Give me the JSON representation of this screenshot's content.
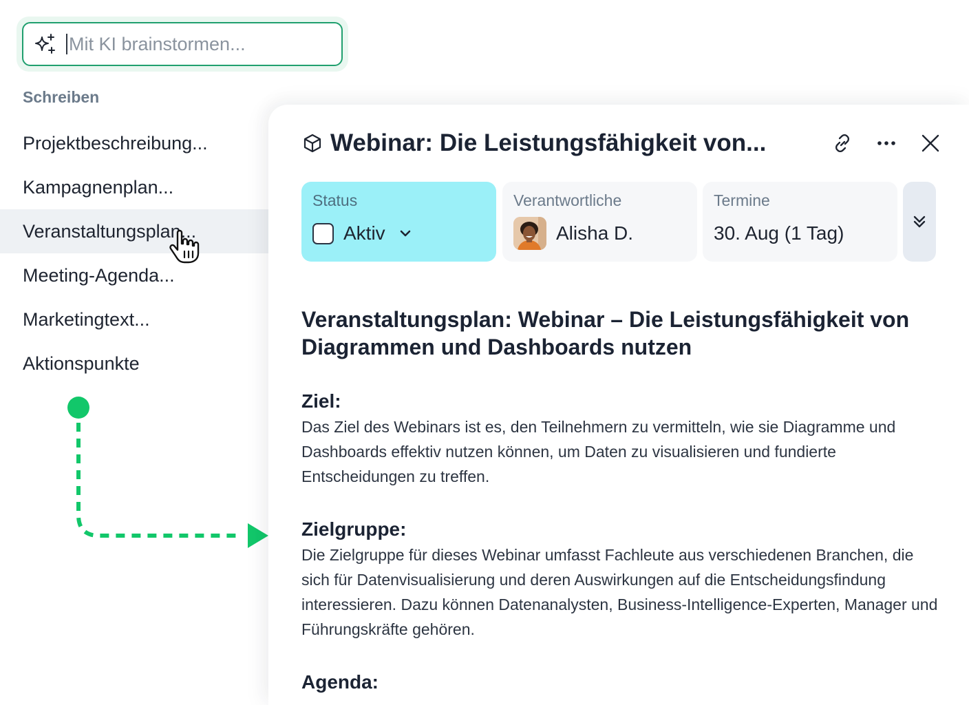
{
  "ai_input": {
    "placeholder": "Mit KI brainstormen...",
    "icon": "sparkles-icon"
  },
  "menu": {
    "section_label": "Schreiben",
    "items": [
      {
        "label": "Projektbeschreibung..."
      },
      {
        "label": "Kampagnenplan..."
      },
      {
        "label": "Veranstaltungsplan..."
      },
      {
        "label": "Meeting-Agenda..."
      },
      {
        "label": "Marketingtext..."
      },
      {
        "label": "Aktionspunkte"
      }
    ],
    "active_index": 2
  },
  "panel": {
    "title": "Webinar: Die Leistungsfähigkeit von...",
    "icons": [
      "cube-icon",
      "link-icon",
      "more-icon",
      "close-icon"
    ],
    "fields": {
      "status": {
        "label": "Status",
        "value": "Aktiv"
      },
      "owner": {
        "label": "Verantwortliche",
        "value": "Alisha D."
      },
      "dates": {
        "label": "Termine",
        "value": "30. Aug (1 Tag)"
      }
    }
  },
  "document": {
    "title": "Veranstaltungsplan: Webinar – Die Leistungsfähigkeit von Diagrammen und Dashboards nutzen",
    "sections": [
      {
        "heading": "Ziel:",
        "text": "Das Ziel des Webinars ist es, den Teilnehmern zu vermitteln, wie sie Diagramme und Dashboards effektiv nutzen können, um Daten zu visualisieren und fundierte Entscheidungen zu treffen."
      },
      {
        "heading": "Zielgruppe:",
        "text": "Die Zielgruppe für dieses Webinar umfasst Fachleute aus verschiedenen Branchen, die sich für Datenvisualisierung und deren Auswirkungen auf die Entscheidungsfindung interessieren. Dazu können Datenanalysten, Business-Intelligence-Experten, Manager und Führungskräfte gehören."
      },
      {
        "heading": "Agenda:",
        "text": ""
      }
    ]
  },
  "colors": {
    "accent_green": "#1f9f6e",
    "arrow_green": "#12c76a",
    "status_cyan": "#9bf0f8",
    "muted_text": "#6b7a8a"
  }
}
